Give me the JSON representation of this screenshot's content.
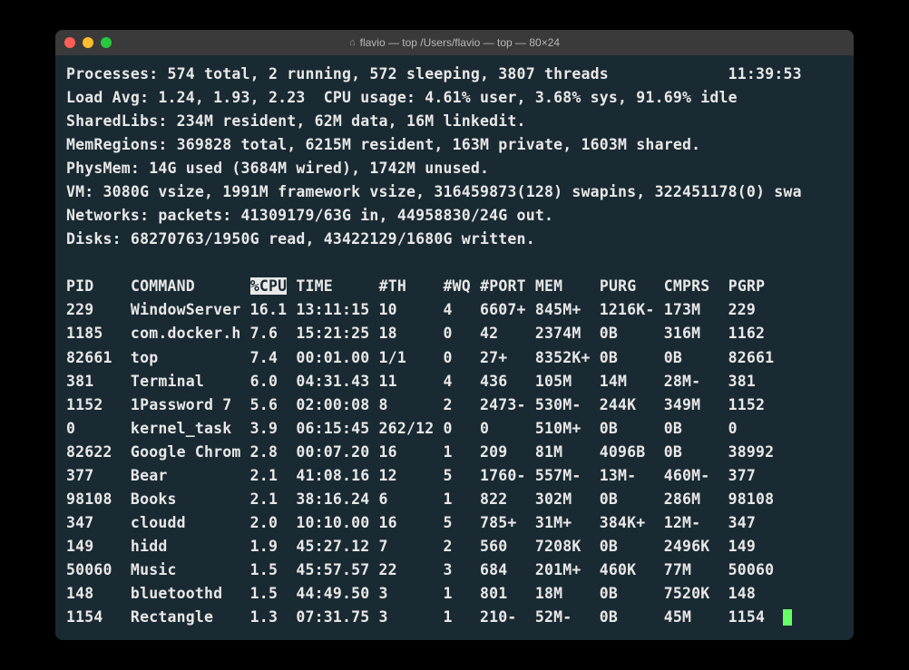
{
  "window": {
    "title": "flavio — top /Users/flavio — top — 80×24"
  },
  "summary": {
    "processes": "Processes: 574 total, 2 running, 572 sleeping, 3807 threads",
    "time": "11:39:53",
    "load": "Load Avg: 1.24, 1.93, 2.23  CPU usage: 4.61% user, 3.68% sys, 91.69% idle",
    "sharedlibs": "SharedLibs: 234M resident, 62M data, 16M linkedit.",
    "memregions": "MemRegions: 369828 total, 6215M resident, 163M private, 1603M shared.",
    "physmem": "PhysMem: 14G used (3684M wired), 1742M unused.",
    "vm": "VM: 3080G vsize, 1991M framework vsize, 316459873(128) swapins, 322451178(0) swa",
    "networks": "Networks: packets: 41309179/63G in, 44958830/24G out.",
    "disks": "Disks: 68270763/1950G read, 43422129/1680G written."
  },
  "columns": {
    "pid": "PID",
    "command": "COMMAND",
    "cpu": "%CPU",
    "time": "TIME",
    "th": "#TH",
    "wq": "#WQ",
    "port": "#PORT",
    "mem": "MEM",
    "purg": "PURG",
    "cmprs": "CMPRS",
    "pgrp": "PGRP"
  },
  "rows": [
    {
      "pid": "229",
      "command": "WindowServer",
      "cpu": "16.1",
      "time": "13:11:15",
      "th": "10",
      "wq": "4",
      "port": "6607+",
      "mem": "845M+",
      "purg": "1216K-",
      "cmprs": "173M",
      "pgrp": "229"
    },
    {
      "pid": "1185",
      "command": "com.docker.h",
      "cpu": "7.6",
      "time": "15:21:25",
      "th": "18",
      "wq": "0",
      "port": "42",
      "mem": "2374M",
      "purg": "0B",
      "cmprs": "316M",
      "pgrp": "1162"
    },
    {
      "pid": "82661",
      "command": "top",
      "cpu": "7.4",
      "time": "00:01.00",
      "th": "1/1",
      "wq": "0",
      "port": "27+",
      "mem": "8352K+",
      "purg": "0B",
      "cmprs": "0B",
      "pgrp": "82661"
    },
    {
      "pid": "381",
      "command": "Terminal",
      "cpu": "6.0",
      "time": "04:31.43",
      "th": "11",
      "wq": "4",
      "port": "436",
      "mem": "105M",
      "purg": "14M",
      "cmprs": "28M-",
      "pgrp": "381"
    },
    {
      "pid": "1152",
      "command": "1Password 7",
      "cpu": "5.6",
      "time": "02:00:08",
      "th": "8",
      "wq": "2",
      "port": "2473-",
      "mem": "530M-",
      "purg": "244K",
      "cmprs": "349M",
      "pgrp": "1152"
    },
    {
      "pid": "0",
      "command": "kernel_task",
      "cpu": "3.9",
      "time": "06:15:45",
      "th": "262/12",
      "wq": "0",
      "port": "0",
      "mem": "510M+",
      "purg": "0B",
      "cmprs": "0B",
      "pgrp": "0"
    },
    {
      "pid": "82622",
      "command": "Google Chrom",
      "cpu": "2.8",
      "time": "00:07.20",
      "th": "16",
      "wq": "1",
      "port": "209",
      "mem": "81M",
      "purg": "4096B",
      "cmprs": "0B",
      "pgrp": "38992"
    },
    {
      "pid": "377",
      "command": "Bear",
      "cpu": "2.1",
      "time": "41:08.16",
      "th": "12",
      "wq": "5",
      "port": "1760-",
      "mem": "557M-",
      "purg": "13M-",
      "cmprs": "460M-",
      "pgrp": "377"
    },
    {
      "pid": "98108",
      "command": "Books",
      "cpu": "2.1",
      "time": "38:16.24",
      "th": "6",
      "wq": "1",
      "port": "822",
      "mem": "302M",
      "purg": "0B",
      "cmprs": "286M",
      "pgrp": "98108"
    },
    {
      "pid": "347",
      "command": "cloudd",
      "cpu": "2.0",
      "time": "10:10.00",
      "th": "16",
      "wq": "5",
      "port": "785+",
      "mem": "31M+",
      "purg": "384K+",
      "cmprs": "12M-",
      "pgrp": "347"
    },
    {
      "pid": "149",
      "command": "hidd",
      "cpu": "1.9",
      "time": "45:27.12",
      "th": "7",
      "wq": "2",
      "port": "560",
      "mem": "7208K",
      "purg": "0B",
      "cmprs": "2496K",
      "pgrp": "149"
    },
    {
      "pid": "50060",
      "command": "Music",
      "cpu": "1.5",
      "time": "45:57.57",
      "th": "22",
      "wq": "3",
      "port": "684",
      "mem": "201M+",
      "purg": "460K",
      "cmprs": "77M",
      "pgrp": "50060"
    },
    {
      "pid": "148",
      "command": "bluetoothd",
      "cpu": "1.5",
      "time": "44:49.50",
      "th": "3",
      "wq": "1",
      "port": "801",
      "mem": "18M",
      "purg": "0B",
      "cmprs": "7520K",
      "pgrp": "148"
    },
    {
      "pid": "1154",
      "command": "Rectangle",
      "cpu": "1.3",
      "time": "07:31.75",
      "th": "3",
      "wq": "1",
      "port": "210-",
      "mem": "52M-",
      "purg": "0B",
      "cmprs": "45M",
      "pgrp": "1154"
    }
  ]
}
